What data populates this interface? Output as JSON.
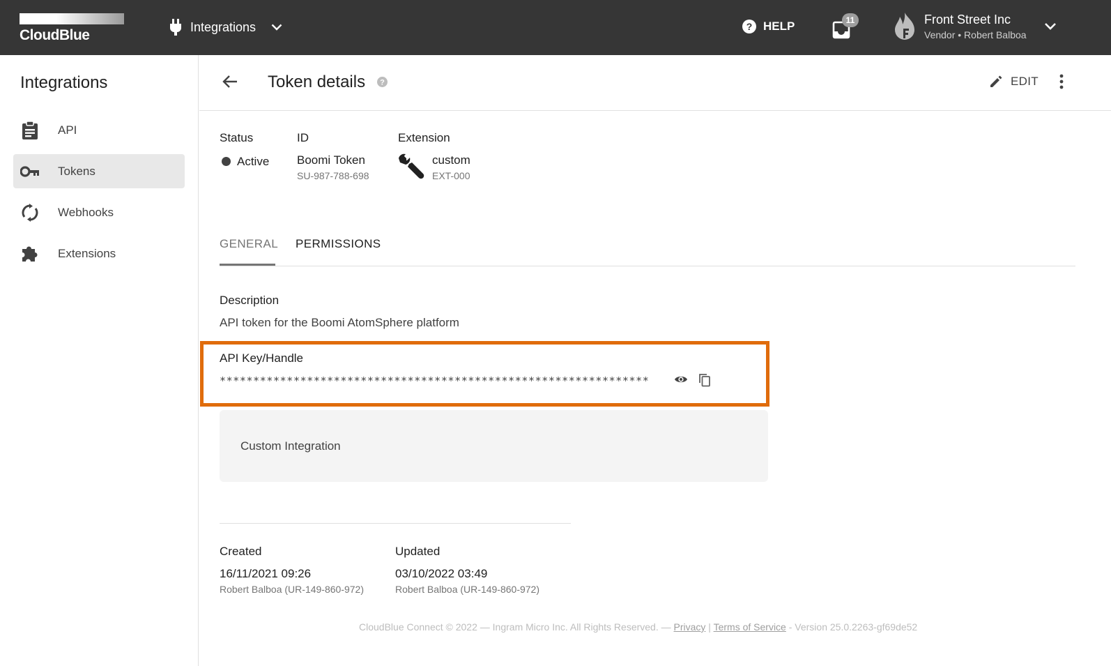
{
  "brand": {
    "logo_text": "CloudBlue"
  },
  "topbar": {
    "module": "Integrations",
    "help": "HELP",
    "notifications_count": "11",
    "account_name": "Front Street Inc",
    "account_sub": "Vendor • Robert Balboa"
  },
  "sidebar": {
    "title": "Integrations",
    "items": [
      {
        "label": "API",
        "icon": "clipboard-icon"
      },
      {
        "label": "Tokens",
        "icon": "key-icon",
        "active": true
      },
      {
        "label": "Webhooks",
        "icon": "sync-icon"
      },
      {
        "label": "Extensions",
        "icon": "puzzle-icon"
      }
    ]
  },
  "header": {
    "title": "Token details",
    "edit": "EDIT"
  },
  "info": {
    "status_label": "Status",
    "status_value": "Active",
    "id_label": "ID",
    "id_name": "Boomi Token",
    "id_code": "SU-987-788-698",
    "extension_label": "Extension",
    "extension_name": "custom",
    "extension_code": "EXT-000"
  },
  "tabs": {
    "general": "GENERAL",
    "permissions": "PERMISSIONS",
    "active": "general"
  },
  "general": {
    "description_label": "Description",
    "description_value": "API token for the Boomi AtomSphere platform",
    "apikey_label": "API Key/Handle",
    "apikey_value": "****************************************************************",
    "custom_integration": "Custom Integration",
    "created_label": "Created",
    "created_date": "16/11/2021 09:26",
    "created_by": "Robert Balboa (UR-149-860-972)",
    "updated_label": "Updated",
    "updated_date": "03/10/2022 03:49",
    "updated_by": "Robert Balboa (UR-149-860-972)"
  },
  "footer": {
    "copyright": "CloudBlue Connect © 2022 — Ingram Micro Inc. All Rights Reserved. — ",
    "privacy": "Privacy",
    "sep": " | ",
    "terms": "Terms of Service",
    "version": " - Version 25.0.2263-gf69de52"
  },
  "colors": {
    "topbar": "#363636",
    "highlight": "#e06c0c"
  }
}
